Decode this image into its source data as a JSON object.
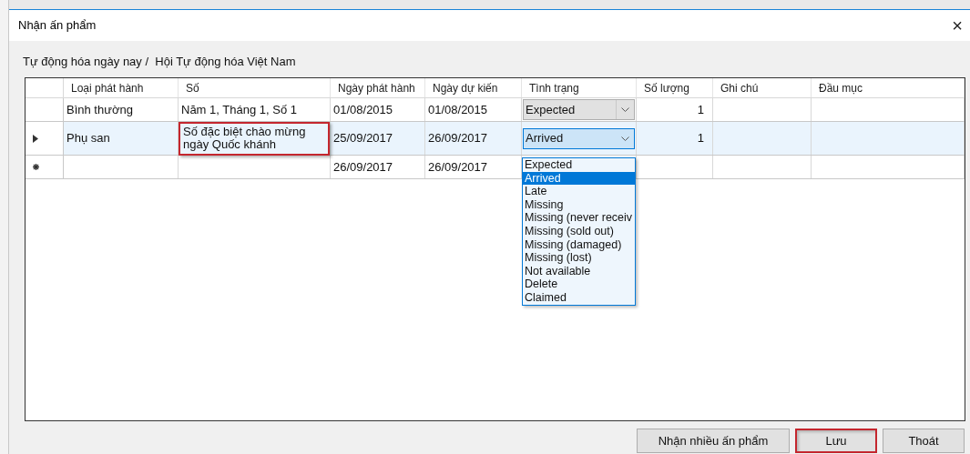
{
  "window": {
    "title": "Nhận ấn phẩm",
    "close": "×"
  },
  "breadcrumb": "Tự động hóa ngày nay /  Hội Tự động hóa Việt Nam",
  "table": {
    "columns": [
      "Loại phát hành",
      "Số",
      "Ngày phát hành",
      "Ngày dự kiến",
      "Tình trạng",
      "Số lượng",
      "Ghi chú",
      "Đầu mục"
    ],
    "rows": [
      {
        "kind": "plain",
        "selected": false,
        "type": "Bình thường",
        "number": "Năm 1, Tháng 1, Số 1",
        "number_highlighted": false,
        "issue_date": "01/08/2015",
        "expected_date": "01/08/2015",
        "status": {
          "value": "Expected",
          "open": false
        },
        "quantity": "1"
      },
      {
        "kind": "current",
        "selected": true,
        "type": "Phụ san",
        "number": "Số đặc biệt chào mừng ngày Quốc khánh",
        "number_highlighted": true,
        "issue_date": "25/09/2017",
        "expected_date": "26/09/2017",
        "status": {
          "value": "Arrived",
          "open": true
        },
        "quantity": "1"
      },
      {
        "kind": "new",
        "selected": false,
        "type": "",
        "number": "",
        "number_highlighted": false,
        "issue_date": "26/09/2017",
        "expected_date": "26/09/2017"
      }
    ]
  },
  "status_options": [
    {
      "label": "Expected",
      "selected": false
    },
    {
      "label": "Arrived",
      "selected": true
    },
    {
      "label": "Late",
      "selected": false
    },
    {
      "label": "Missing",
      "selected": false
    },
    {
      "label": "Missing (never receiv",
      "selected": false
    },
    {
      "label": "Missing (sold out)",
      "selected": false
    },
    {
      "label": "Missing (damaged)",
      "selected": false
    },
    {
      "label": "Missing (lost)",
      "selected": false
    },
    {
      "label": "Not available",
      "selected": false
    },
    {
      "label": "Delete",
      "selected": false
    },
    {
      "label": "Claimed",
      "selected": false
    }
  ],
  "buttons": [
    {
      "label": "Nhận nhiều ấn phẩm",
      "highlighted": false
    },
    {
      "label": "Lưu",
      "highlighted": true
    },
    {
      "label": "Thoát",
      "highlighted": false
    }
  ]
}
